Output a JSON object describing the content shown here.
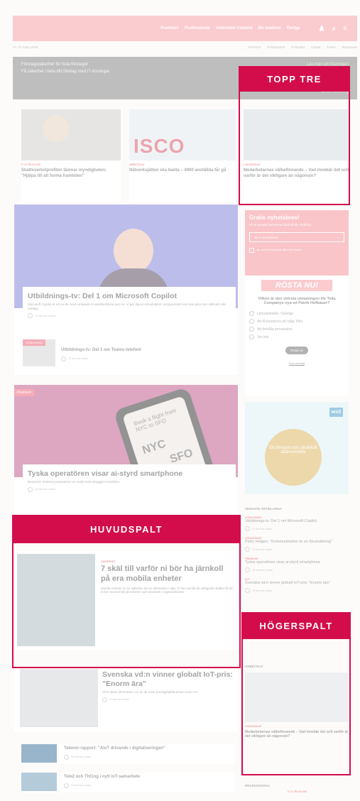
{
  "nav": {
    "items": [
      "Premium",
      "Professional",
      "Unlimited Content",
      "Bli medlem",
      "Övriga"
    ]
  },
  "subbar": {
    "left": "Fri, 27 mars 2026",
    "links": [
      "Premium",
      "Professional",
      "Unlimited",
      "Artiklar",
      "Event",
      "Webinarier"
    ]
  },
  "banner": {
    "line1": "Företagssäkerhet för hela företaget",
    "line2": "Få säkerhet i hela ditt företag med IT-lösningar",
    "cta": "Läs mer om lösningen",
    "brand": "Cloud Security"
  },
  "callouts": {
    "top": "TOPP TRE",
    "main": "HUVUDSPALT",
    "side": "HÖGERSPALT"
  },
  "top_articles": [
    {
      "cat": "IT & Telecom",
      "title": "Skatteverketprofilen lämnar myndigheten: \"Hjälpa till att forma framtiden\""
    },
    {
      "cat": "Arbetsliv",
      "title": "Nätverksjätten ska banta – 4000 anställda får gå"
    },
    {
      "cat": "Ledarskap",
      "title": "Medarbetarnas välbefinnande – Vad innebär det och varför är det viktigare än någonsin?"
    }
  ],
  "feature1": {
    "title": "Utbildnings-tv: Del 1 om Microsoft Copilot",
    "desc": "Microsoft Copilot är en av de mest omtalade AI-assistenterna just nu. Vi ger dig en introduktion i programmet som kan göra stor skillnad i din vardag.",
    "meta": "21 minuter sedan"
  },
  "sub1": {
    "title": "Utbildnings-tv: Del 1 om Teams-telefoni",
    "meta": "21 timmar sedan",
    "tag": "UTBILDNING"
  },
  "feature2": {
    "tag": "Premium",
    "title": "Tyska operatören visar ai-styrd smartphone",
    "desc": "Deutsche Telekom presenterar en mobil med inbyggd AI-funktion.",
    "meta": "18 minuter sedan",
    "screen": "Book a flight from NYC to SFO",
    "nyc": "NYC",
    "sfo": "SFO"
  },
  "feature3": {
    "cat": "Säkerhet",
    "title": "7 skäl till varför ni bör ha järnkoll på era mobila enheter",
    "desc": "Mobila enheter är en självklar del av arbetslivet i dag. Vi har samlat de viktigaste skälen till att ni bör ha kontroll på enheter som används i organisationen."
  },
  "feature4": {
    "title": "Svenska vd:n vinner globalt IoT-pris: \"Enorm ära\"",
    "desc": "Vd:n utses till vinnare i en av de mest prestigefyllda prisen inom IoT.",
    "meta": "12 timmar sedan"
  },
  "list": [
    {
      "title": "Telenor-rapport: \"AIoT drivande i digitaliseringen\"",
      "meta": "22 timmar sedan"
    },
    {
      "title": "Tele2 och Tht1ng i nytt IoT-samarbete",
      "meta": "22 timmar sedan"
    }
  ],
  "newsletter": {
    "title": "Gratis nyhetsbrev!",
    "desc": "Få de senaste nyheterna direkt till din mejlkorg",
    "placeholder": "Din e-postadress",
    "check": "Ja, prenumerera på våra nyhetsbrev"
  },
  "poll": {
    "badge": "RÖSTA NU!",
    "question": "Vilken är den största utmaningen för Telia Companys nya vd Patrik Hofbauer?",
    "options": [
      "Lönsamheten i Sverige",
      "Att få kunderna att välja Telia",
      "Att behålla personalen",
      "Vet inte"
    ],
    "vote": "Rösta nu",
    "results": "Visa resultat"
  },
  "ad": {
    "badge": "wx3",
    "text": "Ett lönsamt och värdefullt affärsområde"
  },
  "right_section": "Senaste artiklarna",
  "right_items": [
    {
      "cat": "Utbildning",
      "title": "Utbildnings-tv: Del 1 om Microsoft Copilot",
      "meta": "21 timmar sedan"
    },
    {
      "cat": "Ledarskap",
      "title": "Peter Holgen: \"Kommunikation är en förutsättning\"",
      "meta": "21 timmar sedan"
    },
    {
      "cat": "Premium",
      "title": "Tyska operatören visar ai-styrd smartphone",
      "meta": "18 minuter sedan"
    },
    {
      "cat": "IoT",
      "title": "Svenska vd:n vinner globalt IoT-pris: \"Enorm ära\"",
      "meta": "12 timmar sedan"
    }
  ],
  "sidebar2": {
    "section": "Arbetsliv",
    "cat": "Ledarskap",
    "title": "Medarbetarnas välbefinnande – Vad innebär det och varför är det viktigare än någonsin?"
  },
  "sidebar3": {
    "section": "Professional",
    "cat": "IT & Telecom"
  }
}
